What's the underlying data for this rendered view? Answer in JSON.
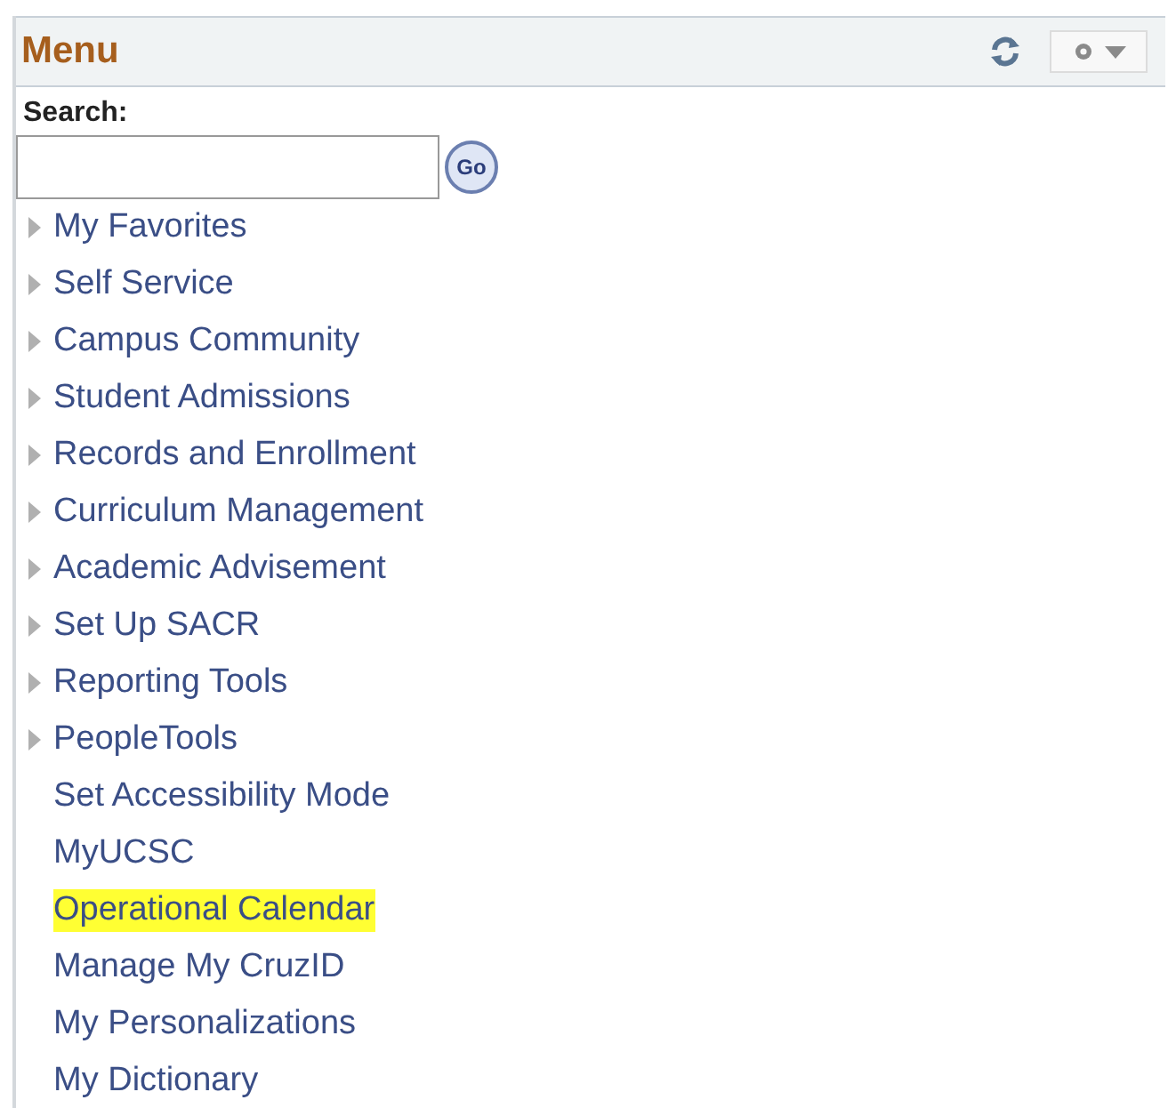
{
  "panel": {
    "title": "Menu"
  },
  "search": {
    "label": "Search:",
    "go": "Go"
  },
  "items": [
    {
      "label": "My Favorites",
      "kind": "folder",
      "highlighted": false
    },
    {
      "label": "Self Service",
      "kind": "folder",
      "highlighted": false
    },
    {
      "label": "Campus Community",
      "kind": "folder",
      "highlighted": false
    },
    {
      "label": "Student Admissions",
      "kind": "folder",
      "highlighted": false
    },
    {
      "label": "Records and Enrollment",
      "kind": "folder",
      "highlighted": false
    },
    {
      "label": "Curriculum Management",
      "kind": "folder",
      "highlighted": false
    },
    {
      "label": "Academic Advisement",
      "kind": "folder",
      "highlighted": false
    },
    {
      "label": "Set Up SACR",
      "kind": "folder",
      "highlighted": false
    },
    {
      "label": "Reporting Tools",
      "kind": "folder",
      "highlighted": false
    },
    {
      "label": "PeopleTools",
      "kind": "folder",
      "highlighted": false
    },
    {
      "label": "Set Accessibility Mode",
      "kind": "link",
      "highlighted": false
    },
    {
      "label": "MyUCSC",
      "kind": "link",
      "highlighted": false
    },
    {
      "label": "Operational Calendar",
      "kind": "link",
      "highlighted": true
    },
    {
      "label": "Manage My CruzID",
      "kind": "link",
      "highlighted": false
    },
    {
      "label": "My Personalizations",
      "kind": "link",
      "highlighted": false
    },
    {
      "label": "My Dictionary",
      "kind": "link",
      "highlighted": false
    }
  ]
}
